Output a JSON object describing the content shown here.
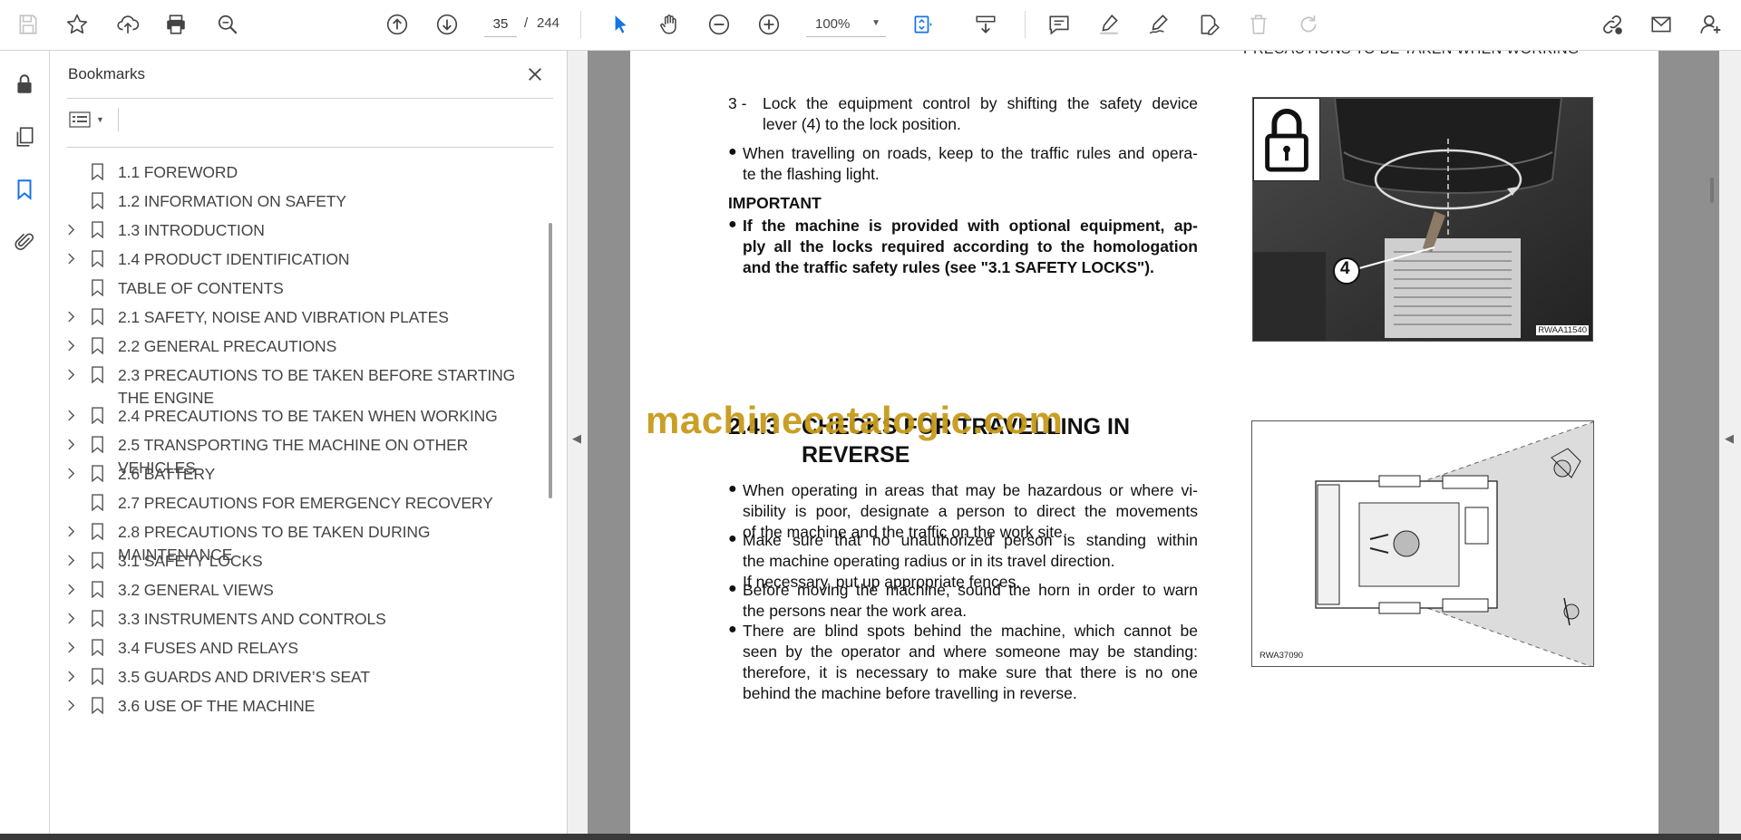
{
  "toolbar": {
    "page_current": "35",
    "page_separator": "/",
    "page_total": "244",
    "zoom": "100%",
    "icons": [
      "save-icon",
      "star-icon",
      "upload-icon",
      "print-icon",
      "zoom-search-icon",
      "page-up-icon",
      "page-down-icon",
      "zoom-out-icon",
      "zoom-in-icon",
      "zoom-dropdown",
      "select-cursor-icon",
      "hand-icon",
      "marquee-zoom-icon",
      "scroll-down-icon",
      "comment-icon",
      "highlight-icon",
      "sign-icon",
      "edit-pdf-icon",
      "delete-icon",
      "redo-icon",
      "share-link-icon",
      "email-icon",
      "account-icon"
    ]
  },
  "rail": {
    "icons": [
      "lock-icon",
      "pages-icon",
      "bookmark-icon",
      "attachment-icon"
    ]
  },
  "bookmarks": {
    "title": "Bookmarks",
    "items": [
      {
        "label": "1.1 FOREWORD",
        "expandable": false
      },
      {
        "label": "1.2 INFORMATION ON SAFETY",
        "expandable": false
      },
      {
        "label": "1.3 INTRODUCTION",
        "expandable": true
      },
      {
        "label": "1.4 PRODUCT IDENTIFICATION",
        "expandable": true
      },
      {
        "label": "TABLE OF CONTENTS",
        "expandable": false
      },
      {
        "label": "2.1 SAFETY, NOISE AND VIBRATION PLATES",
        "expandable": true
      },
      {
        "label": "2.2 GENERAL PRECAUTIONS",
        "expandable": true
      },
      {
        "label": "2.3 PRECAUTIONS TO BE TAKEN BEFORE STARTING THE ENGINE",
        "expandable": true
      },
      {
        "label": "2.4 PRECAUTIONS TO BE TAKEN WHEN WORKING",
        "expandable": true
      },
      {
        "label": "2.5 TRANSPORTING THE MACHINE ON OTHER VEHICLES",
        "expandable": true
      },
      {
        "label": "2.6 BATTERY",
        "expandable": true
      },
      {
        "label": "2.7 PRECAUTIONS FOR EMERGENCY RECOVERY",
        "expandable": false
      },
      {
        "label": "2.8 PRECAUTIONS TO BE TAKEN DURING MAINTENANCE",
        "expandable": true
      },
      {
        "label": "3.1 SAFETY LOCKS",
        "expandable": true
      },
      {
        "label": "3.2 GENERAL VIEWS",
        "expandable": true
      },
      {
        "label": "3.3 INSTRUMENTS AND CONTROLS",
        "expandable": true
      },
      {
        "label": "3.4 FUSES AND RELAYS",
        "expandable": true
      },
      {
        "label": "3.5 GUARDS AND DRIVER’S SEAT",
        "expandable": true
      },
      {
        "label": "3.6 USE OF THE MACHINE",
        "expandable": true
      }
    ]
  },
  "document": {
    "running_header": "PRECAUTIONS TO BE TAKEN WHEN WORKING",
    "step3_number": "3 -",
    "step3_line1": "Lock the equipment control by shifting the safety device",
    "step3_line2": "lever (4) to the lock position.",
    "bullet_roads_line1": "When travelling on roads, keep to the traffic rules and opera-",
    "bullet_roads_line2": "te the flashing light.",
    "important_heading": "IMPORTANT",
    "important_line1": "If the machine is provided with optional equipment, ap-",
    "important_line2": "ply all the locks required according to the homologation",
    "important_line3": "and the traffic safety rules (see \"3.1 SAFETY LOCKS\").",
    "section_number": "2.4.3",
    "section_title_line1": "CHECKS FOR TRAVELLING IN",
    "section_title_line2": "REVERSE",
    "watermark": "machinecatalogic.com",
    "bullets": [
      [
        "When operating in areas that may be hazardous or where vi-",
        "sibility is poor, designate a person to direct the movements",
        "of the machine and the traffic on the work site."
      ],
      [
        "Make sure that no unauthorized person is standing within",
        "the machine operating radius or in its travel direction.",
        "If necessary, put up appropriate fences."
      ],
      [
        "Before moving the machine, sound the horn in order to warn",
        "the persons near the work area."
      ],
      [
        "There are blind spots behind the machine, which cannot be",
        "seen by the operator and where someone may be standing:",
        "therefore, it is necessary to make sure that there is no one",
        "behind the machine before travelling in reverse."
      ]
    ],
    "figure1_code": "RWAA11540",
    "figure1_callout": "4",
    "figure2_code": "RWA37090"
  },
  "colors": {
    "accent": "#1473e6",
    "watermark": "#c79a1a",
    "doc_bg": "#8f8f8f"
  }
}
